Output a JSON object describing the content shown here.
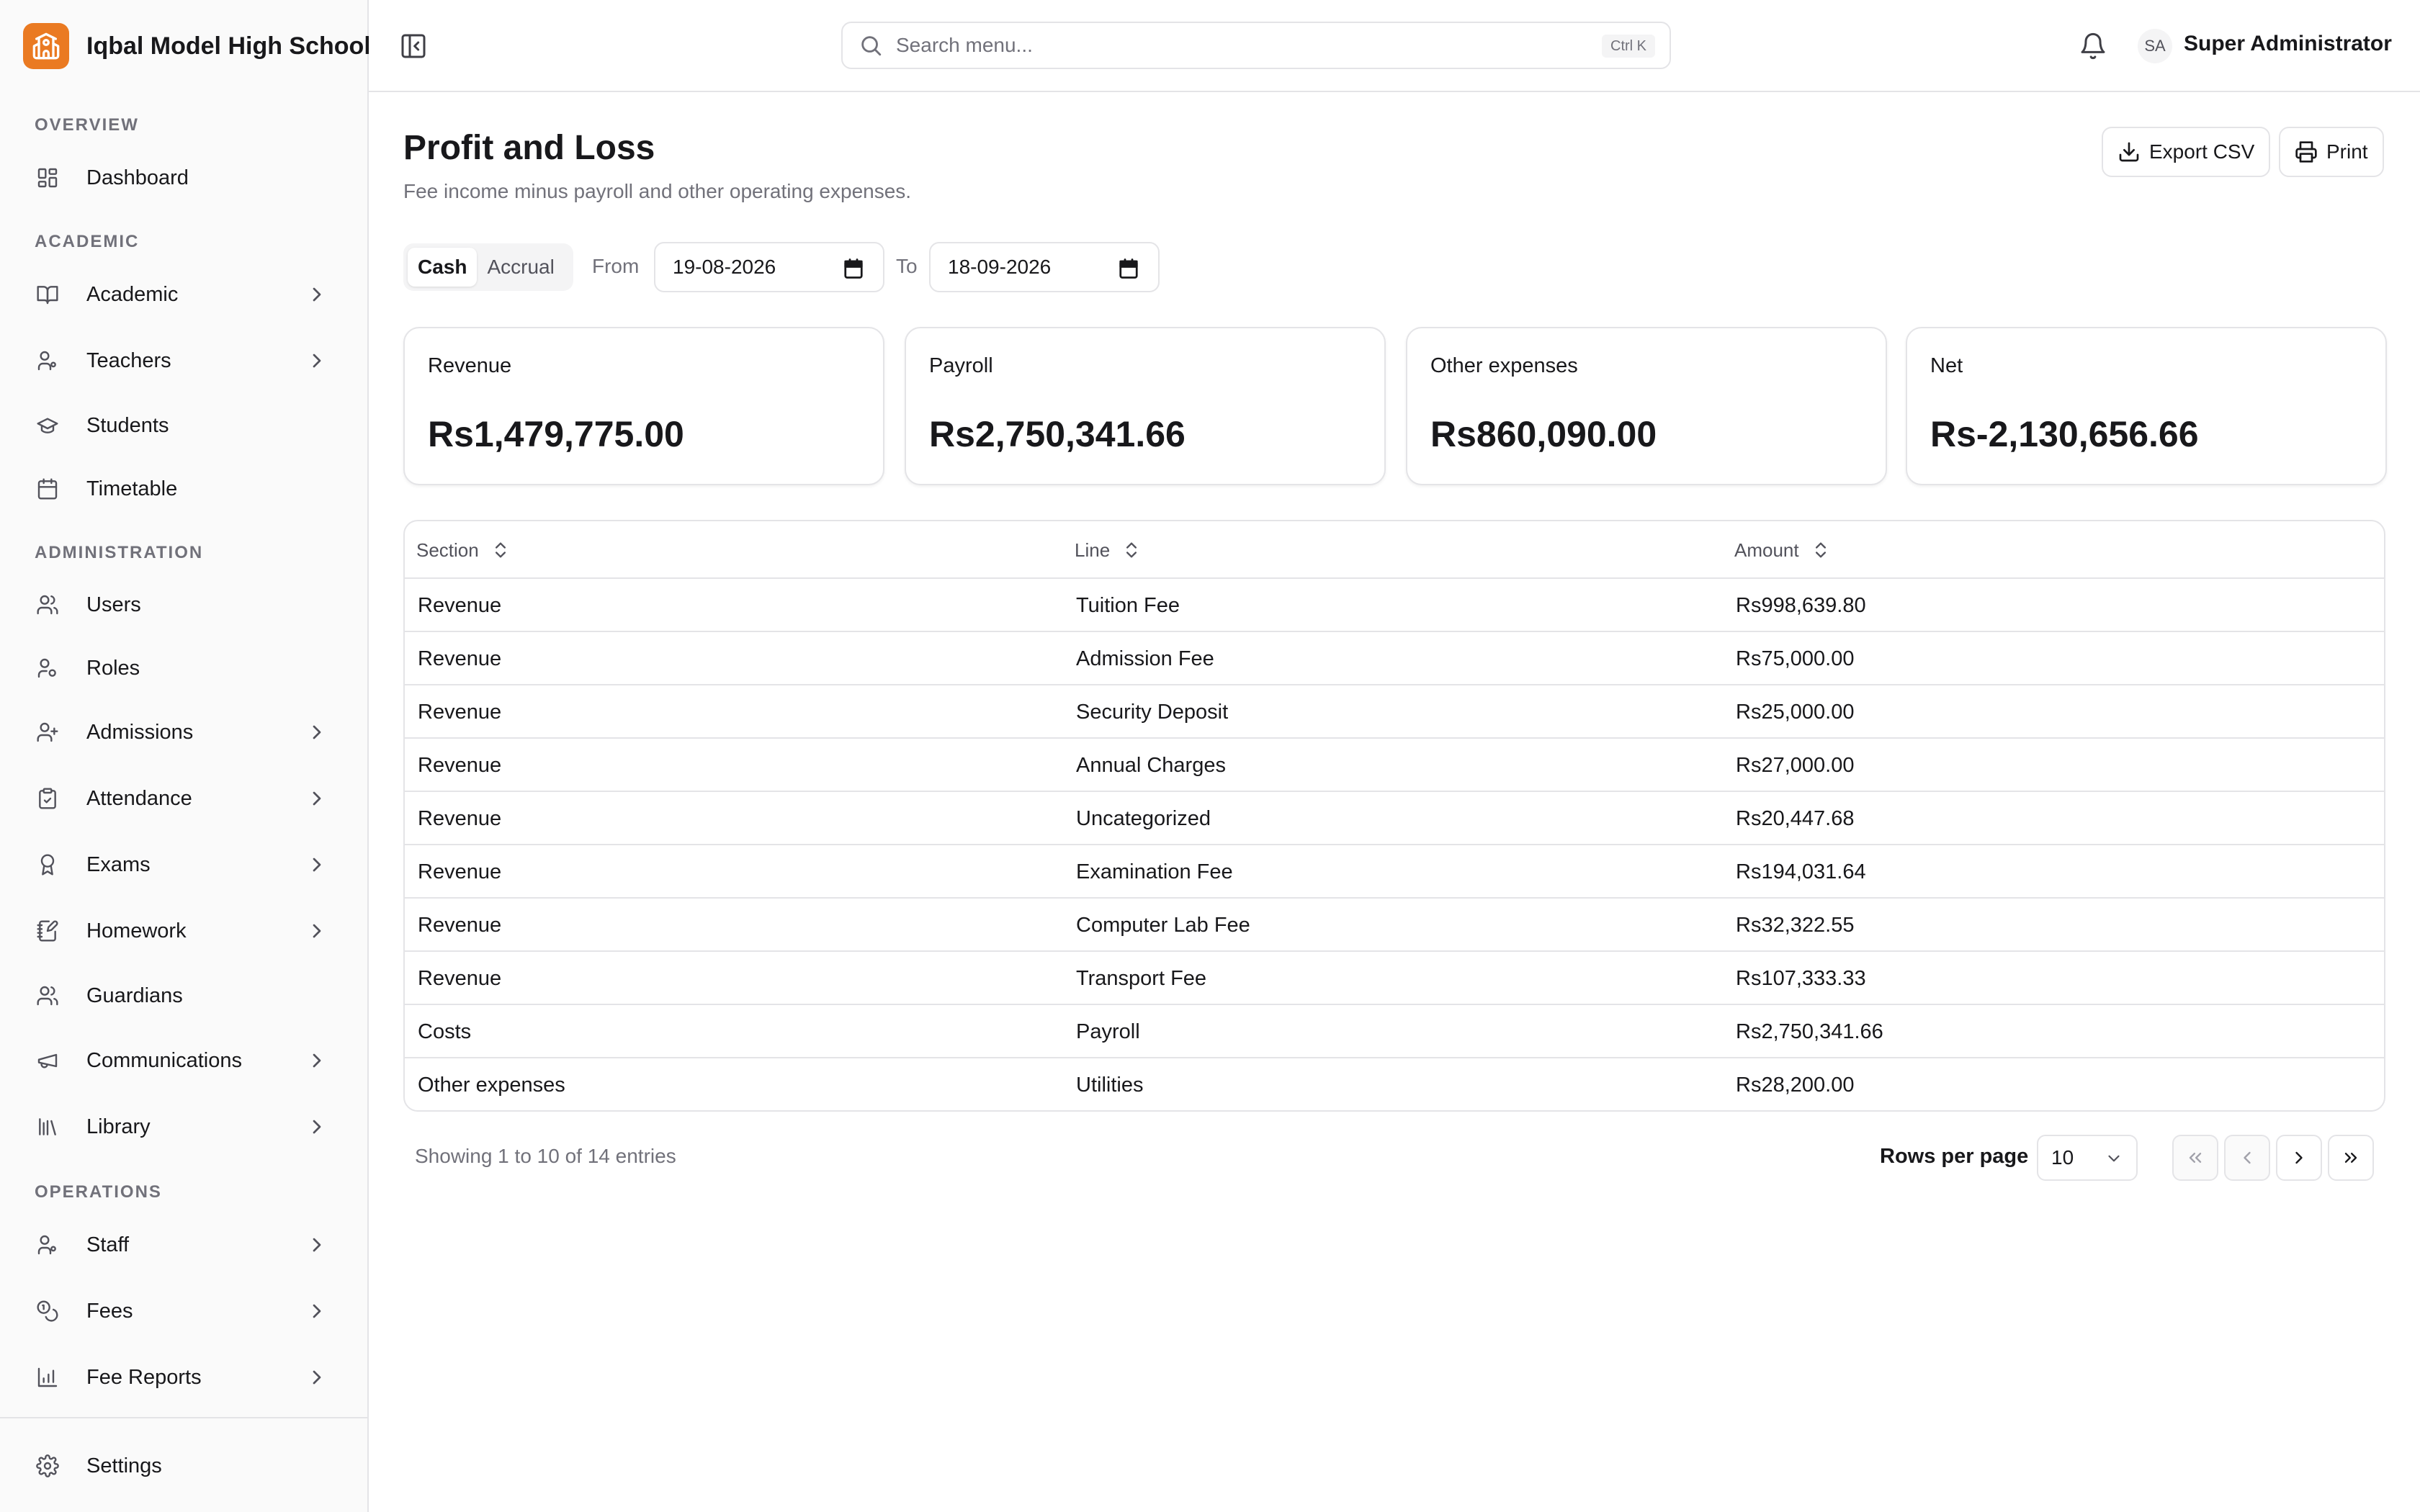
{
  "brand": {
    "name": "Iqbal Model High School"
  },
  "sidebar": {
    "sections": [
      {
        "title": "OVERVIEW",
        "items": [
          {
            "label": "Dashboard",
            "icon": "dashboard-icon",
            "has_children": false
          }
        ]
      },
      {
        "title": "ACADEMIC",
        "items": [
          {
            "label": "Academic",
            "icon": "book-icon",
            "has_children": true
          },
          {
            "label": "Teachers",
            "icon": "user-icon",
            "has_children": true
          },
          {
            "label": "Students",
            "icon": "graduation-cap-icon",
            "has_children": false
          },
          {
            "label": "Timetable",
            "icon": "calendar-icon",
            "has_children": false
          }
        ]
      },
      {
        "title": "ADMINISTRATION",
        "items": [
          {
            "label": "Users",
            "icon": "users-icon",
            "has_children": false
          },
          {
            "label": "Roles",
            "icon": "user-key-icon",
            "has_children": false
          },
          {
            "label": "Admissions",
            "icon": "user-plus-icon",
            "has_children": true
          },
          {
            "label": "Attendance",
            "icon": "clipboard-check-icon",
            "has_children": true
          },
          {
            "label": "Exams",
            "icon": "award-icon",
            "has_children": true
          },
          {
            "label": "Homework",
            "icon": "notebook-pen-icon",
            "has_children": true
          },
          {
            "label": "Guardians",
            "icon": "users-icon",
            "has_children": false
          },
          {
            "label": "Communications",
            "icon": "megaphone-icon",
            "has_children": true
          },
          {
            "label": "Library",
            "icon": "library-icon",
            "has_children": true
          }
        ]
      },
      {
        "title": "OPERATIONS",
        "items": [
          {
            "label": "Staff",
            "icon": "user-icon",
            "has_children": true
          },
          {
            "label": "Fees",
            "icon": "coins-icon",
            "has_children": true
          },
          {
            "label": "Fee Reports",
            "icon": "bar-chart-icon",
            "has_children": true
          }
        ]
      }
    ],
    "footer": {
      "label": "Settings",
      "icon": "gear-icon"
    }
  },
  "header": {
    "search": {
      "placeholder": "Search menu...",
      "value": "",
      "shortcut": "Ctrl K"
    },
    "user": {
      "initials": "SA",
      "name": "Super Administrator"
    }
  },
  "page": {
    "title": "Profit and Loss",
    "subtitle": "Fee income minus payroll and other operating expenses.",
    "actions": {
      "export_label": "Export CSV",
      "print_label": "Print"
    }
  },
  "filters": {
    "basis_options": [
      "Cash",
      "Accrual"
    ],
    "basis_selected": "Cash",
    "from_label": "From",
    "from_value": "19-08-2026",
    "to_label": "To",
    "to_value": "18-09-2026"
  },
  "summary": [
    {
      "label": "Revenue",
      "value": "Rs1,479,775.00"
    },
    {
      "label": "Payroll",
      "value": "Rs2,750,341.66"
    },
    {
      "label": "Other expenses",
      "value": "Rs860,090.00"
    },
    {
      "label": "Net",
      "value": "Rs-2,130,656.66"
    }
  ],
  "table": {
    "columns": [
      "Section",
      "Line",
      "Amount"
    ],
    "rows": [
      {
        "section": "Revenue",
        "line": "Tuition Fee",
        "amount": "Rs998,639.80"
      },
      {
        "section": "Revenue",
        "line": "Admission Fee",
        "amount": "Rs75,000.00"
      },
      {
        "section": "Revenue",
        "line": "Security Deposit",
        "amount": "Rs25,000.00"
      },
      {
        "section": "Revenue",
        "line": "Annual Charges",
        "amount": "Rs27,000.00"
      },
      {
        "section": "Revenue",
        "line": "Uncategorized",
        "amount": "Rs20,447.68"
      },
      {
        "section": "Revenue",
        "line": "Examination Fee",
        "amount": "Rs194,031.64"
      },
      {
        "section": "Revenue",
        "line": "Computer Lab Fee",
        "amount": "Rs32,322.55"
      },
      {
        "section": "Revenue",
        "line": "Transport Fee",
        "amount": "Rs107,333.33"
      },
      {
        "section": "Costs",
        "line": "Payroll",
        "amount": "Rs2,750,341.66"
      },
      {
        "section": "Other expenses",
        "line": "Utilities",
        "amount": "Rs28,200.00"
      }
    ]
  },
  "pagination": {
    "showing_text": "Showing 1 to 10 of 14 entries",
    "rows_per_page_label": "Rows per page",
    "rows_per_page_value": "10"
  },
  "colors": {
    "accent": "#ea7a22",
    "border": "#e4e4e7",
    "muted": "#71717a"
  }
}
